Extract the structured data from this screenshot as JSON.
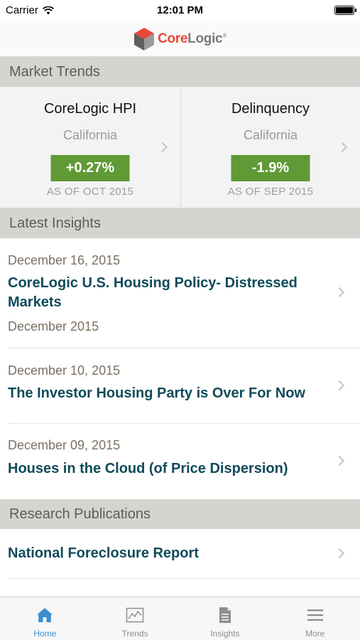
{
  "status_bar": {
    "carrier": "Carrier",
    "time": "12:01 PM"
  },
  "header": {
    "logo_core": "Core",
    "logo_logic": "Logic",
    "logo_mark": "®"
  },
  "market_trends": {
    "heading": "Market Trends",
    "cards": [
      {
        "title": "CoreLogic HPI",
        "region": "California",
        "value": "+0.27%",
        "as_of": "AS OF OCT 2015"
      },
      {
        "title": "Delinquency",
        "region": "California",
        "value": "-1.9%",
        "as_of": "AS OF SEP 2015"
      }
    ]
  },
  "latest_insights": {
    "heading": "Latest Insights",
    "items": [
      {
        "date": "December 16, 2015",
        "title": "CoreLogic U.S. Housing Policy- Distressed Markets",
        "subtitle": "December 2015"
      },
      {
        "date": "December 10, 2015",
        "title": "The Investor Housing Party is Over For Now",
        "subtitle": ""
      },
      {
        "date": "December 09, 2015",
        "title": "Houses in the Cloud (of Price Dispersion)",
        "subtitle": ""
      }
    ]
  },
  "research_publications": {
    "heading": "Research Publications",
    "items": [
      {
        "title": "National Foreclosure Report"
      }
    ]
  },
  "tab_bar": {
    "active_color": "#3b8fd1",
    "tabs": [
      {
        "label": "Home",
        "icon": "home-icon"
      },
      {
        "label": "Trends",
        "icon": "chart-icon"
      },
      {
        "label": "Insights",
        "icon": "document-icon"
      },
      {
        "label": "More",
        "icon": "menu-icon"
      }
    ]
  },
  "colors": {
    "value_badge": "#5f9a35",
    "link_title": "#0f4a5a",
    "section_header": "#d6d4ce",
    "logo_red": "#e8483a"
  }
}
